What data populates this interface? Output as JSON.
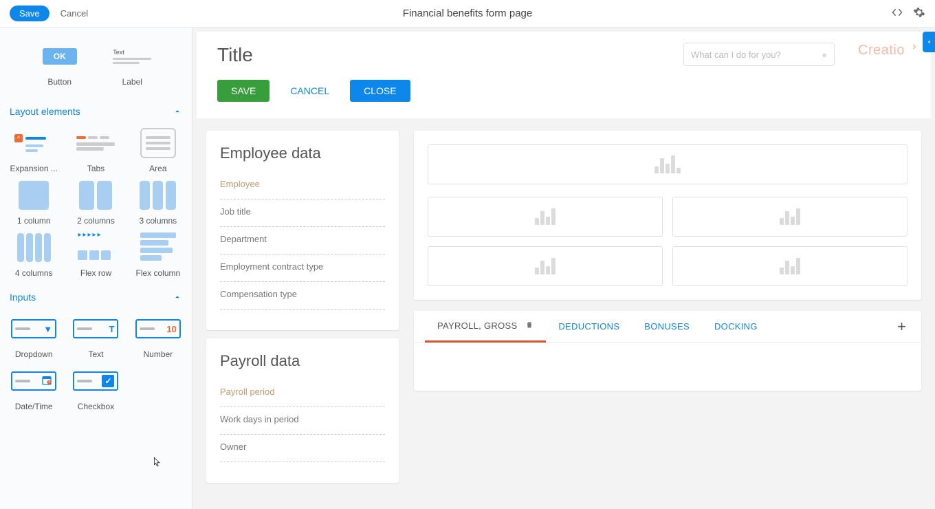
{
  "topbar": {
    "save": "Save",
    "cancel": "Cancel",
    "title": "Financial benefits form page"
  },
  "palette": {
    "basic": {
      "button": "Button",
      "button_preview": "OK",
      "label": "Label",
      "label_preview": "Text"
    },
    "layout_section": "Layout elements",
    "layout": {
      "expansion": "Expansion ...",
      "tabs": "Tabs",
      "area": "Area",
      "col1": "1 column",
      "col2": "2 columns",
      "col3": "3 columns",
      "col4": "4 columns",
      "flexrow": "Flex row",
      "flexcol": "Flex column"
    },
    "inputs_section": "Inputs",
    "inputs": {
      "dropdown": "Dropdown",
      "text": "Text",
      "text_glyph": "T",
      "number": "Number",
      "number_glyph": "10",
      "datetime": "Date/Time",
      "checkbox": "Checkbox"
    }
  },
  "canvas": {
    "title": "Title",
    "search_placeholder": "What can I do for you?",
    "logo": "Creatio",
    "buttons": {
      "save": "SAVE",
      "cancel": "CANCEL",
      "close": "CLOSE"
    },
    "emp_section": {
      "heading": "Employee data",
      "fields": [
        "Employee",
        "Job title",
        "Department",
        "Employment contract type",
        "Compensation type"
      ]
    },
    "payroll_section": {
      "heading": "Payroll data",
      "fields": [
        "Payroll period",
        "Work days in period",
        "Owner"
      ]
    },
    "tabs": [
      "PAYROLL, GROSS",
      "DEDUCTIONS",
      "BONUSES",
      "DOCKING"
    ]
  }
}
